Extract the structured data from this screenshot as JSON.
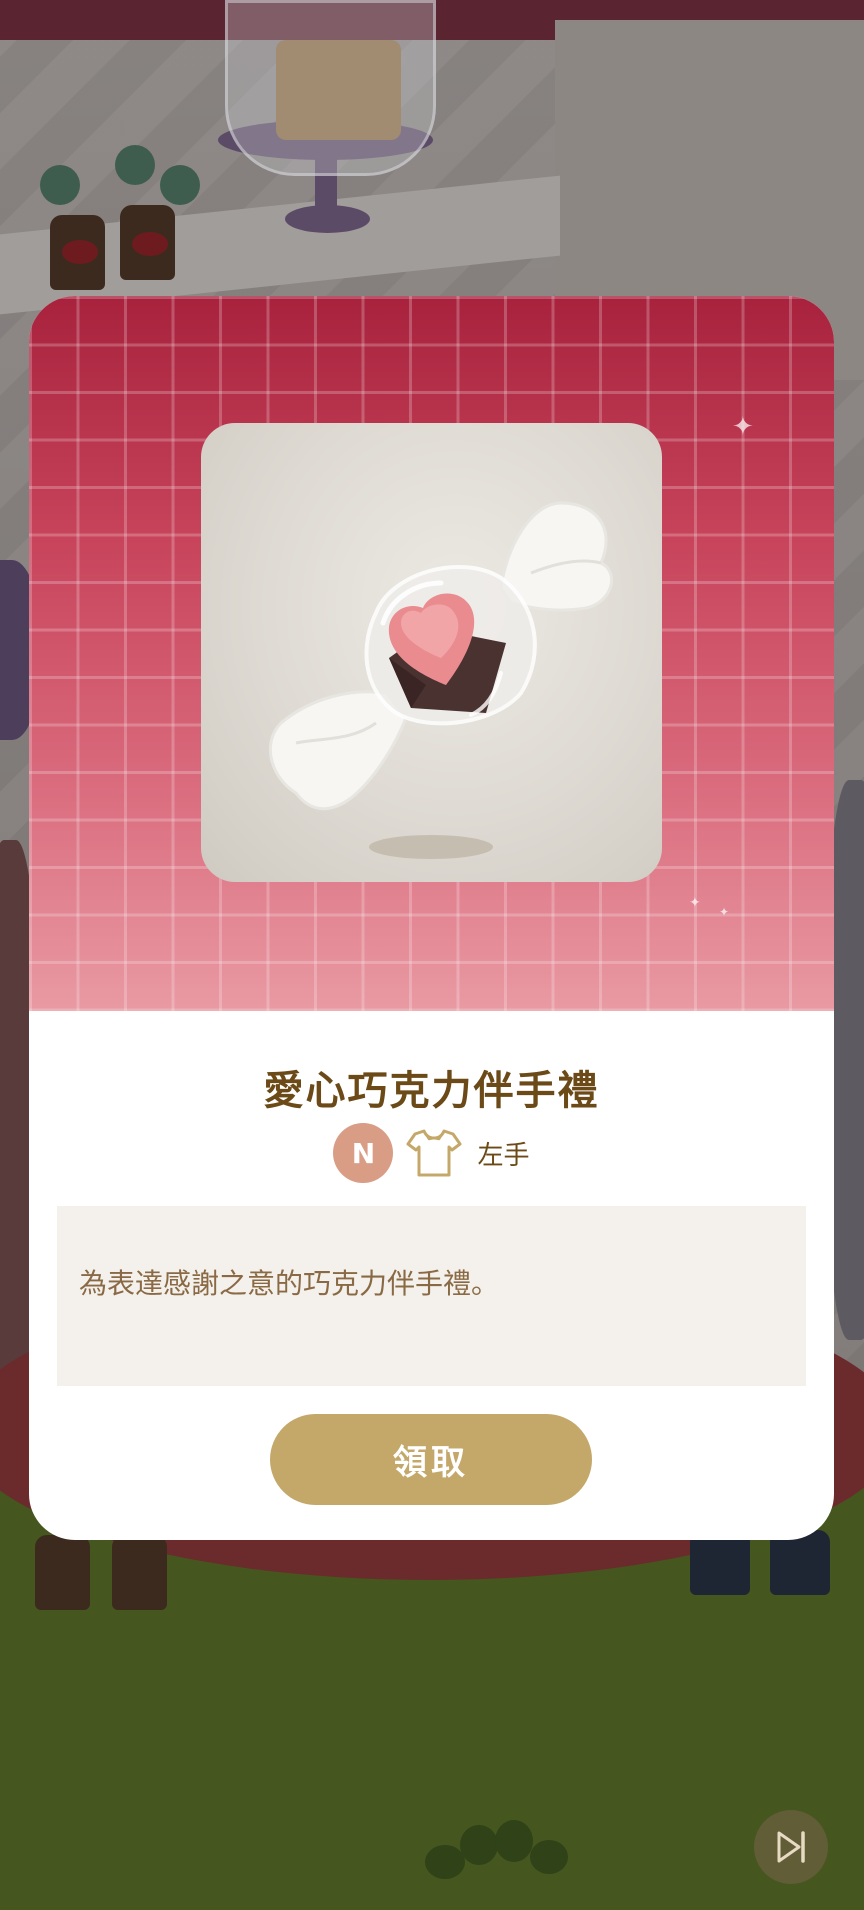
{
  "item": {
    "name": "愛心巧克力伴手禮",
    "rarity": "N",
    "slot_icon": "shirt-icon",
    "slot_label": "左手",
    "description": "為表達感謝之意的巧克力伴手禮。"
  },
  "actions": {
    "claim_label": "領取",
    "skip_icon": "skip-forward-icon"
  },
  "colors": {
    "title_brown": "#6b4a17",
    "button_gold": "#c4a86a",
    "rarity_badge": "#d99d86",
    "hero_top": "#a8223d",
    "hero_bottom": "#e99aa3"
  }
}
